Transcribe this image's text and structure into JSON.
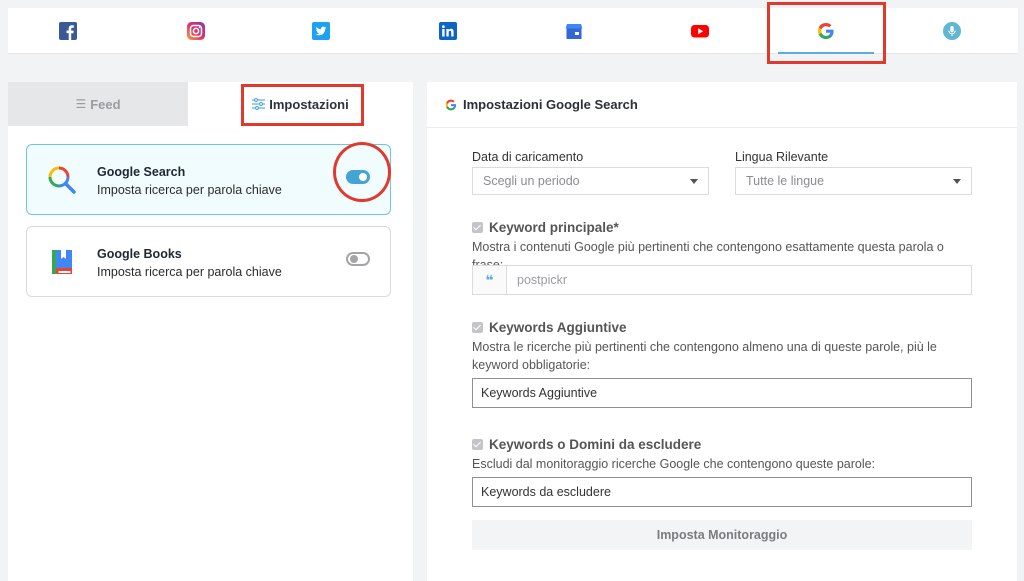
{
  "networks": [
    {
      "name": "facebook",
      "icon": "facebook-icon",
      "color": "#3b5998"
    },
    {
      "name": "instagram",
      "icon": "instagram-icon",
      "color": "#e1306c"
    },
    {
      "name": "twitter",
      "icon": "twitter-icon",
      "color": "#1da1f2"
    },
    {
      "name": "linkedin",
      "icon": "linkedin-icon",
      "color": "#0a66c2"
    },
    {
      "name": "google-my-business",
      "icon": "store-icon",
      "color": "#4285f4"
    },
    {
      "name": "youtube",
      "icon": "youtube-icon",
      "color": "#ff0000"
    },
    {
      "name": "google",
      "icon": "google-icon",
      "color": "#4285f4",
      "active": true
    },
    {
      "name": "podcast",
      "icon": "microphone-icon",
      "color": "#5fb7d0"
    }
  ],
  "left_tabs": {
    "feed_label": "Feed",
    "settings_label": "Impostazioni"
  },
  "sources": [
    {
      "title": "Google Search",
      "subtitle": "Imposta ricerca per parola chiave",
      "icon": "google-search-icon",
      "enabled": true
    },
    {
      "title": "Google Books",
      "subtitle": "Imposta ricerca per parola chiave",
      "icon": "google-books-icon",
      "enabled": false
    }
  ],
  "settings": {
    "title": "Impostazioni Google Search",
    "upload_date": {
      "label": "Data di caricamento",
      "value": "Scegli un periodo"
    },
    "language": {
      "label": "Lingua Rilevante",
      "value": "Tutte le lingue"
    },
    "main_keyword": {
      "title": "Keyword principale*",
      "description": "Mostra i contenuti Google più pertinenti che contengono esattamente questa parola o frase:",
      "value": "postpickr"
    },
    "additional_keywords": {
      "title": "Keywords Aggiuntive",
      "description": "Mostra le ricerche più pertinenti che contengono almeno una di queste parole, più le keyword obbligatorie:",
      "placeholder": "Keywords Aggiuntive"
    },
    "exclude": {
      "title": "Keywords o Domini da escludere",
      "description": "Escludi dal monitoraggio ricerche Google che contengono queste parole:",
      "placeholder": "Keywords da escludere"
    },
    "submit_label": "Imposta Monitoraggio"
  },
  "colors": {
    "accent": "#44a4d3",
    "highlight": "#e03a2f"
  }
}
